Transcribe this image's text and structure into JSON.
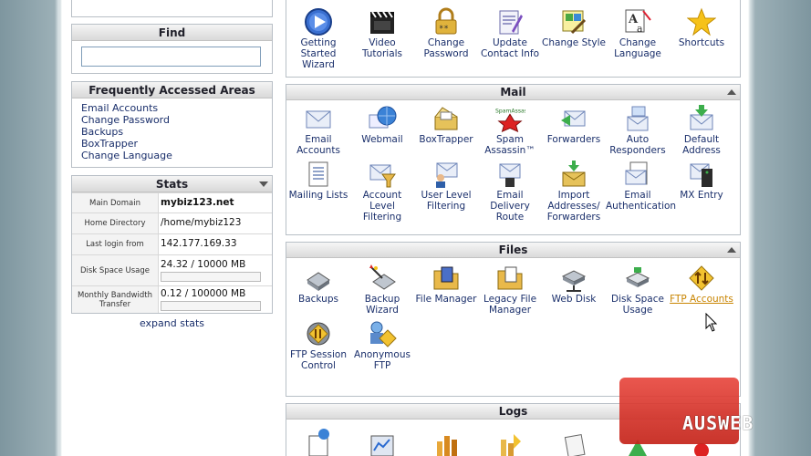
{
  "sidebar": {
    "find": {
      "title": "Find",
      "placeholder": ""
    },
    "faa": {
      "title": "Frequently Accessed Areas",
      "links": [
        "Email Accounts",
        "Change Password",
        "Backups",
        "BoxTrapper",
        "Change Language"
      ]
    },
    "stats": {
      "title": "Stats",
      "rows": [
        {
          "label": "Main Domain",
          "value": "mybiz123.net"
        },
        {
          "label": "Home Directory",
          "value": "/home/mybiz123"
        },
        {
          "label": "Last login from",
          "value": "142.177.169.33"
        },
        {
          "label": "Disk Space Usage",
          "value": "24.32 / 10000 MB"
        },
        {
          "label": "Monthly Bandwidth Transfer",
          "value": "0.12 / 100000 MB"
        }
      ],
      "expand": "expand stats"
    }
  },
  "preferences": {
    "items": [
      {
        "label": "Getting Started Wizard",
        "icon": "wizard-play-icon"
      },
      {
        "label": "Video Tutorials",
        "icon": "clapperboard-icon"
      },
      {
        "label": "Change Password",
        "icon": "padlock-icon"
      },
      {
        "label": "Update Contact Info",
        "icon": "contact-card-icon"
      },
      {
        "label": "Change Style",
        "icon": "style-palette-icon"
      },
      {
        "label": "Change Language",
        "icon": "language-icon"
      },
      {
        "label": "Shortcuts",
        "icon": "star-icon"
      }
    ]
  },
  "mail": {
    "title": "Mail",
    "items": [
      {
        "label": "Email Accounts",
        "icon": "envelope-icon"
      },
      {
        "label": "Webmail",
        "icon": "webmail-globe-icon"
      },
      {
        "label": "BoxTrapper",
        "icon": "boxtrapper-icon"
      },
      {
        "label": "Spam Assassin™",
        "icon": "spamassassin-icon"
      },
      {
        "label": "Forwarders",
        "icon": "forward-envelope-icon"
      },
      {
        "label": "Auto Responders",
        "icon": "auto-responder-icon"
      },
      {
        "label": "Default Address",
        "icon": "default-address-icon"
      },
      {
        "label": "Mailing Lists",
        "icon": "mailing-list-icon"
      },
      {
        "label": "Account Level Filtering",
        "icon": "account-filter-icon"
      },
      {
        "label": "User Level Filtering",
        "icon": "user-filter-icon"
      },
      {
        "label": "Email Delivery Route",
        "icon": "delivery-route-icon"
      },
      {
        "label": "Import Addresses/ Forwarders",
        "icon": "import-addresses-icon"
      },
      {
        "label": "Email Authentication",
        "icon": "email-auth-icon"
      },
      {
        "label": "MX Entry",
        "icon": "mx-entry-icon"
      }
    ]
  },
  "files": {
    "title": "Files",
    "items": [
      {
        "label": "Backups",
        "icon": "backup-disk-icon"
      },
      {
        "label": "Backup Wizard",
        "icon": "backup-wizard-icon"
      },
      {
        "label": "File Manager",
        "icon": "folder-icon"
      },
      {
        "label": "Legacy File Manager",
        "icon": "legacy-folder-icon"
      },
      {
        "label": "Web Disk",
        "icon": "web-disk-icon"
      },
      {
        "label": "Disk Space Usage",
        "icon": "disk-usage-icon"
      },
      {
        "label": "FTP Accounts",
        "icon": "ftp-accounts-icon"
      },
      {
        "label": "FTP Session Control",
        "icon": "ftp-session-icon"
      },
      {
        "label": "Anonymous FTP",
        "icon": "anonymous-ftp-icon"
      }
    ]
  },
  "logs": {
    "title": "Logs"
  },
  "watermark": {
    "text": "AUSWEB"
  }
}
